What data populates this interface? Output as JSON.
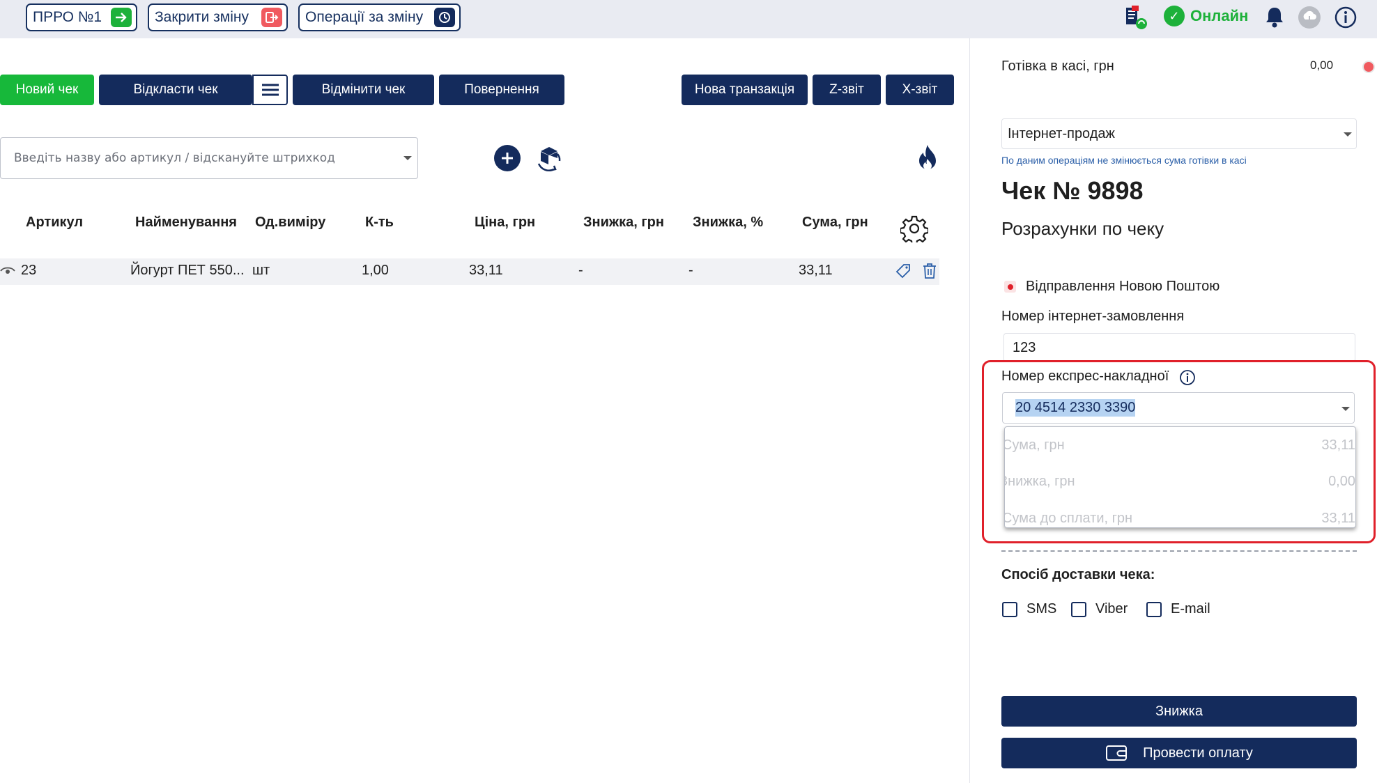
{
  "topbar": {
    "prro_label": "ПРРО №1",
    "close_shift_label": "Закрити зміну",
    "shift_ops_label": "Операції за зміну",
    "online_label": "Онлайн"
  },
  "actions": {
    "new_check": "Новий чек",
    "postpone_check": "Відкласти чек",
    "cancel_check": "Відмінити чек",
    "refund": "Повернення",
    "new_transaction": "Нова транзакція",
    "z_report": "Z-звіт",
    "x_report": "X-звіт"
  },
  "search": {
    "placeholder": "Введіть назву або артикул / відскануйте штрихкод"
  },
  "table": {
    "columns": [
      "Артикул",
      "Найменування",
      "Од.виміру",
      "К-ть",
      "Ціна, грн",
      "Знижка, грн",
      "Знижка, %",
      "Сума, грн"
    ],
    "rows": [
      {
        "article": "23",
        "name": "Йогурт ПЕТ 550...",
        "unit": "шт",
        "qty": "1,00",
        "price": "33,11",
        "discount_uah": "-",
        "discount_pct": "-",
        "sum": "33,11"
      }
    ]
  },
  "right": {
    "cash_label": "Готівка в касі, грн",
    "cash_value": "0,00",
    "sale_type": "Інтернет-продаж",
    "sale_note": "По даним операціям не змінюється сума готівки в касі",
    "check_title": "Чек № 9898",
    "calc_title": "Розрахунки по чеку",
    "np_label": "Відправлення Новою Поштою",
    "order_label": "Номер інтернет-замовлення",
    "order_value": "123",
    "waybill_label": "Номер експрес-накладної",
    "waybill_value": "20 4514 2330 3390",
    "dropdown": [
      {
        "label": "Сума, грн",
        "value": "33,11"
      },
      {
        "label": "Знижка, грн",
        "value": "0,00"
      },
      {
        "label": "Сума до сплати, грн",
        "value": "33,11"
      }
    ],
    "delivery_label": "Спосіб доставки чека:",
    "delivery_options": [
      "SMS",
      "Viber",
      "E-mail"
    ],
    "discount_button": "Знижка",
    "pay_button": "Провести оплату"
  },
  "colors": {
    "primary": "#142b5c",
    "green": "#17b83a",
    "red": "#e0202a"
  }
}
